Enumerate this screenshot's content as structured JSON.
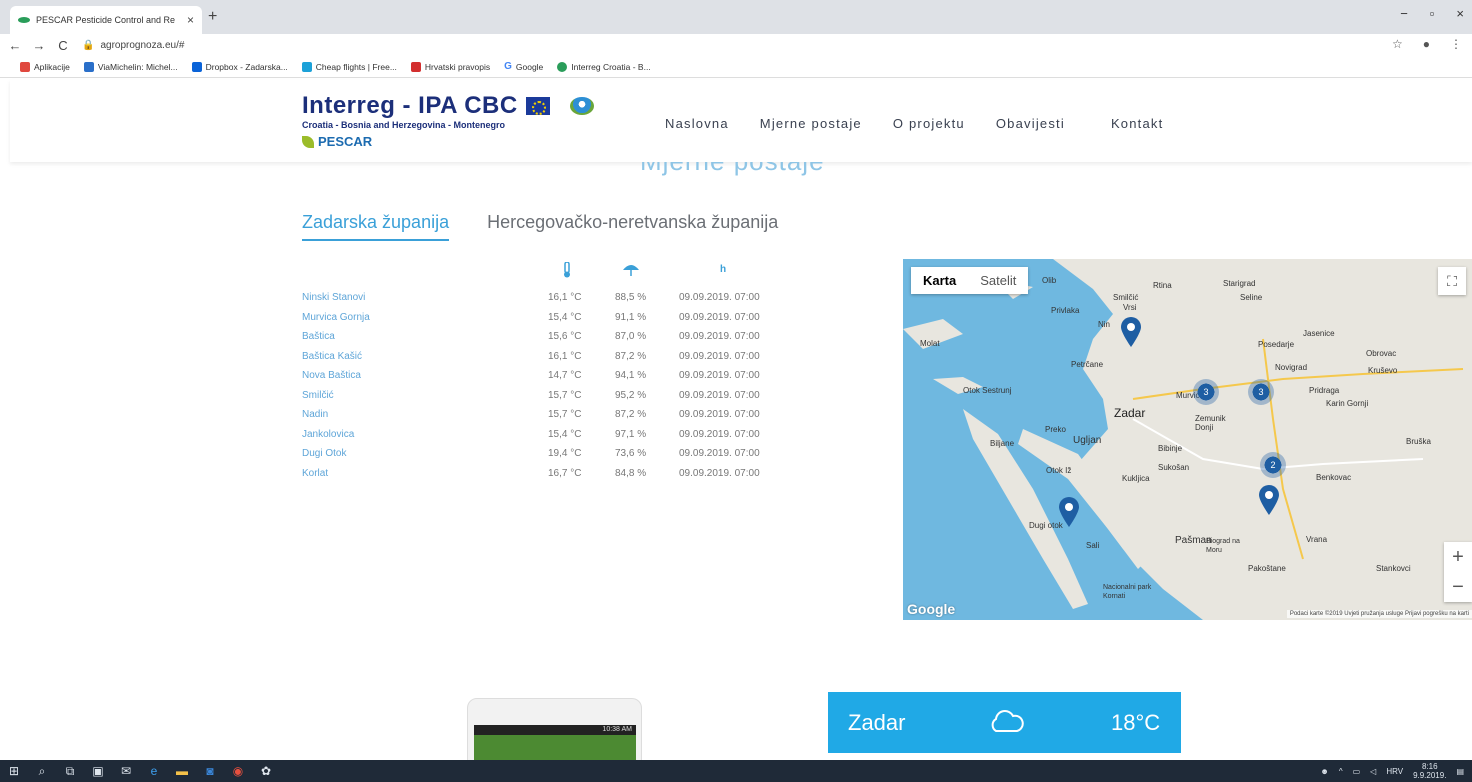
{
  "browser": {
    "tab_title": "PESCAR Pesticide Control and Re",
    "tab_close": "×",
    "new_tab": "+",
    "window_controls": [
      "−",
      "▫",
      "×"
    ],
    "url": "agroprognoza.eu/#",
    "bookmarks": [
      {
        "label": "Aplikacije",
        "color": "#e0483e"
      },
      {
        "label": "ViaMichelin: Michel...",
        "color": "#2a6fc9"
      },
      {
        "label": "Dropbox - Zadarska...",
        "color": "#0a63d8"
      },
      {
        "label": "Cheap flights | Free...",
        "color": "#1ca1d8"
      },
      {
        "label": "Hrvatski pravopis",
        "color": "#d32f2f"
      },
      {
        "label": "Google",
        "color": "#4285f4"
      },
      {
        "label": "Interreg Croatia - B...",
        "color": "#2a9d5a"
      }
    ]
  },
  "site": {
    "logo_title": "Interreg - IPA CBC",
    "logo_subtitle": "Croatia - Bosnia and Herzegovina - Montenegro",
    "logo_project": "PESCAR",
    "nav": [
      "Naslovna",
      "Mjerne postaje",
      "O projektu",
      "Obavijesti",
      "Kontakt"
    ]
  },
  "main": {
    "section_title": "Mjerne postaje",
    "tabs": [
      "Zadarska županija",
      "Hercegovačko-neretvanska županija"
    ],
    "header_icons": {
      "temperature": "thermometer-icon",
      "humidity": "umbrella-icon",
      "time": "h"
    },
    "stations": [
      {
        "name": "Ninski Stanovi",
        "temp": "16,1 °C",
        "humidity": "88,5 %",
        "time": "09.09.2019. 07:00"
      },
      {
        "name": "Murvica Gornja",
        "temp": "15,4 °C",
        "humidity": "91,1 %",
        "time": "09.09.2019. 07:00"
      },
      {
        "name": "Baštica",
        "temp": "15,6 °C",
        "humidity": "87,0 %",
        "time": "09.09.2019. 07:00"
      },
      {
        "name": "Baštica Kašić",
        "temp": "16,1 °C",
        "humidity": "87,2 %",
        "time": "09.09.2019. 07:00"
      },
      {
        "name": "Nova Baštica",
        "temp": "14,7 °C",
        "humidity": "94,1 %",
        "time": "09.09.2019. 07:00"
      },
      {
        "name": "Smilčić",
        "temp": "15,7 °C",
        "humidity": "95,2 %",
        "time": "09.09.2019. 07:00"
      },
      {
        "name": "Nadin",
        "temp": "15,7 °C",
        "humidity": "87,2 %",
        "time": "09.09.2019. 07:00"
      },
      {
        "name": "Jankolovica",
        "temp": "15,4 °C",
        "humidity": "97,1 %",
        "time": "09.09.2019. 07:00"
      },
      {
        "name": "Dugi Otok",
        "temp": "19,4 °C",
        "humidity": "73,6 %",
        "time": "09.09.2019. 07:00"
      },
      {
        "name": "Korlat",
        "temp": "16,7 °C",
        "humidity": "84,8 %",
        "time": "09.09.2019. 07:00"
      }
    ]
  },
  "map": {
    "type_map": "Karta",
    "type_satellite": "Satelit",
    "fullscreen_icon": "⛶",
    "zoom_in": "+",
    "zoom_out": "−",
    "google": "Google",
    "attribution": "Podaci karte ©2019   Uvjeti pružanja usluge   Prijavi pogrešku na karti",
    "labels": [
      "Zadar",
      "Ugljan",
      "Dugi otok",
      "Pašman",
      "Nin",
      "Vrsi",
      "Privlaka",
      "Petrčane",
      "Murvica",
      "Posedarje",
      "Novigrad",
      "Obrovac",
      "Benkovac",
      "Biograd na Moru",
      "Pakoštane",
      "Vrana",
      "Kukljica",
      "Sukošan",
      "Sali",
      "Nacionalni park Kornati",
      "Stankovci",
      "Bruška",
      "Karin Gornji",
      "Kruševo",
      "Jasenice",
      "Starigrad",
      "Seline",
      "Rtina",
      "Otok Sestrunj",
      "Molat",
      "Olib",
      "Zemunik Donji",
      "Bibinje",
      "Preko",
      "Otok Iž",
      "Pridraga",
      "Smilčić",
      "Biljane"
    ],
    "clusters": [
      "3",
      "3",
      "2"
    ]
  },
  "weather": {
    "city": "Zadar",
    "icon": "cloud-icon",
    "temp": "18°C"
  },
  "phone": {
    "status_time": "10:38 AM"
  },
  "taskbar": {
    "tray_lang": "HRV",
    "tray_time": "8:16",
    "tray_date": "9.9.2019."
  }
}
